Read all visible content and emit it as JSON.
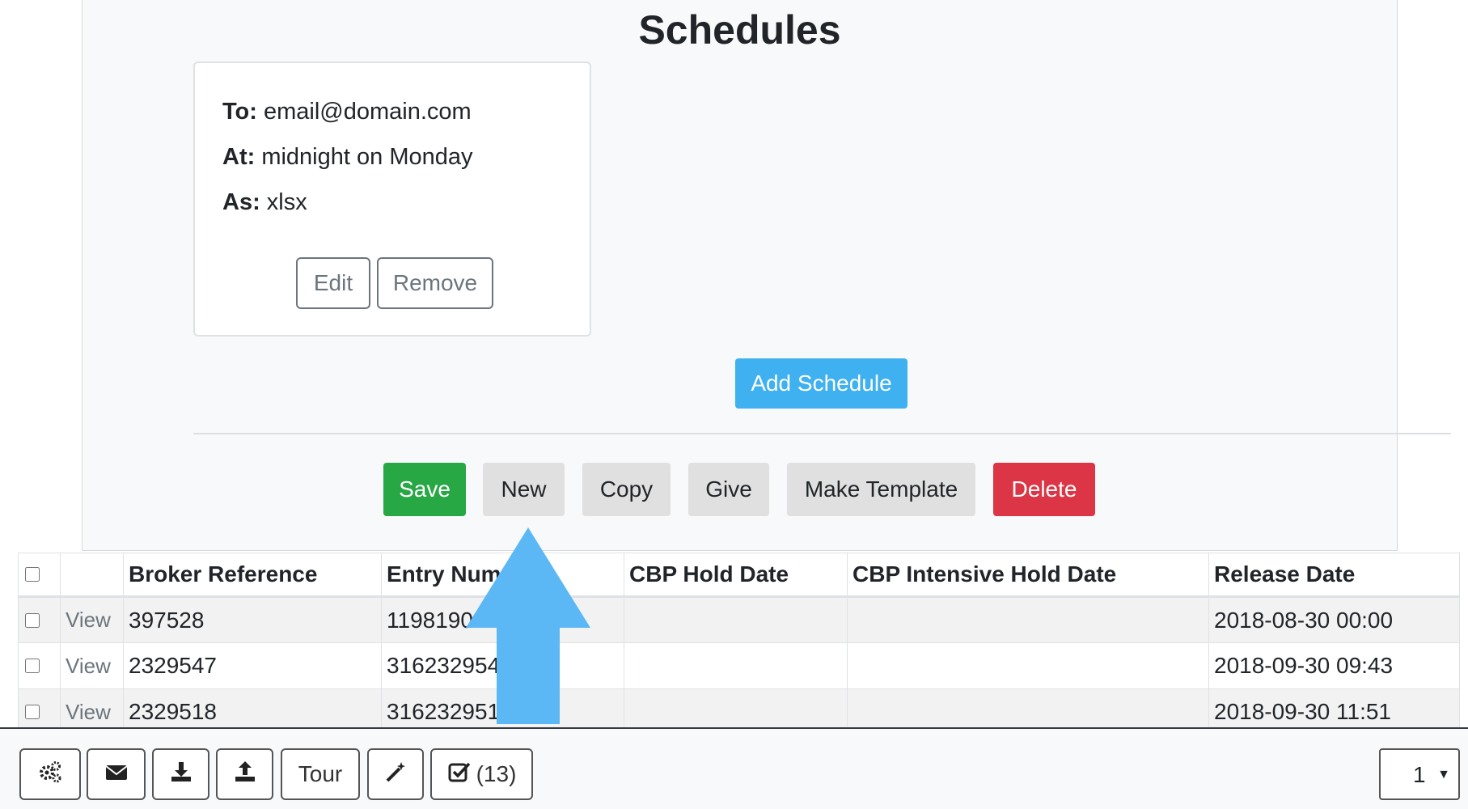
{
  "schedules": {
    "title": "Schedules",
    "card": {
      "to_label": "To:",
      "to_value": "email@domain.com",
      "at_label": "At:",
      "at_value": "midnight on Monday",
      "as_label": "As:",
      "as_value": "xlsx",
      "edit_label": "Edit",
      "remove_label": "Remove"
    },
    "add_label": "Add Schedule"
  },
  "actions": {
    "save": "Save",
    "new": "New",
    "copy": "Copy",
    "give": "Give",
    "make_template": "Make Template",
    "delete": "Delete"
  },
  "table": {
    "headers": [
      "Broker Reference",
      "Entry Num",
      "CBP Hold Date",
      "CBP Intensive Hold Date",
      "Release Date"
    ],
    "view_label": "View",
    "rows": [
      {
        "broker_ref": "397528",
        "entry_num": "1198190",
        "hold": "",
        "intensive": "",
        "release": "2018-08-30 00:00"
      },
      {
        "broker_ref": "2329547",
        "entry_num": "316232954",
        "hold": "",
        "intensive": "",
        "release": "2018-09-30 09:43"
      },
      {
        "broker_ref": "2329518",
        "entry_num": "316232951",
        "hold": "",
        "intensive": "",
        "release": "2018-09-30 11:51"
      }
    ]
  },
  "footer": {
    "tour_label": "Tour",
    "tasks_count": "(13)",
    "page_value": "1",
    "icons": [
      "gears-icon",
      "envelope-icon",
      "download-icon",
      "upload-icon",
      "magic-wand-icon",
      "checkbox-icon"
    ]
  },
  "colors": {
    "save": "#28a745",
    "delete": "#dc3545",
    "add_schedule": "#3fb0f0",
    "arrow": "#5bb8f5"
  }
}
